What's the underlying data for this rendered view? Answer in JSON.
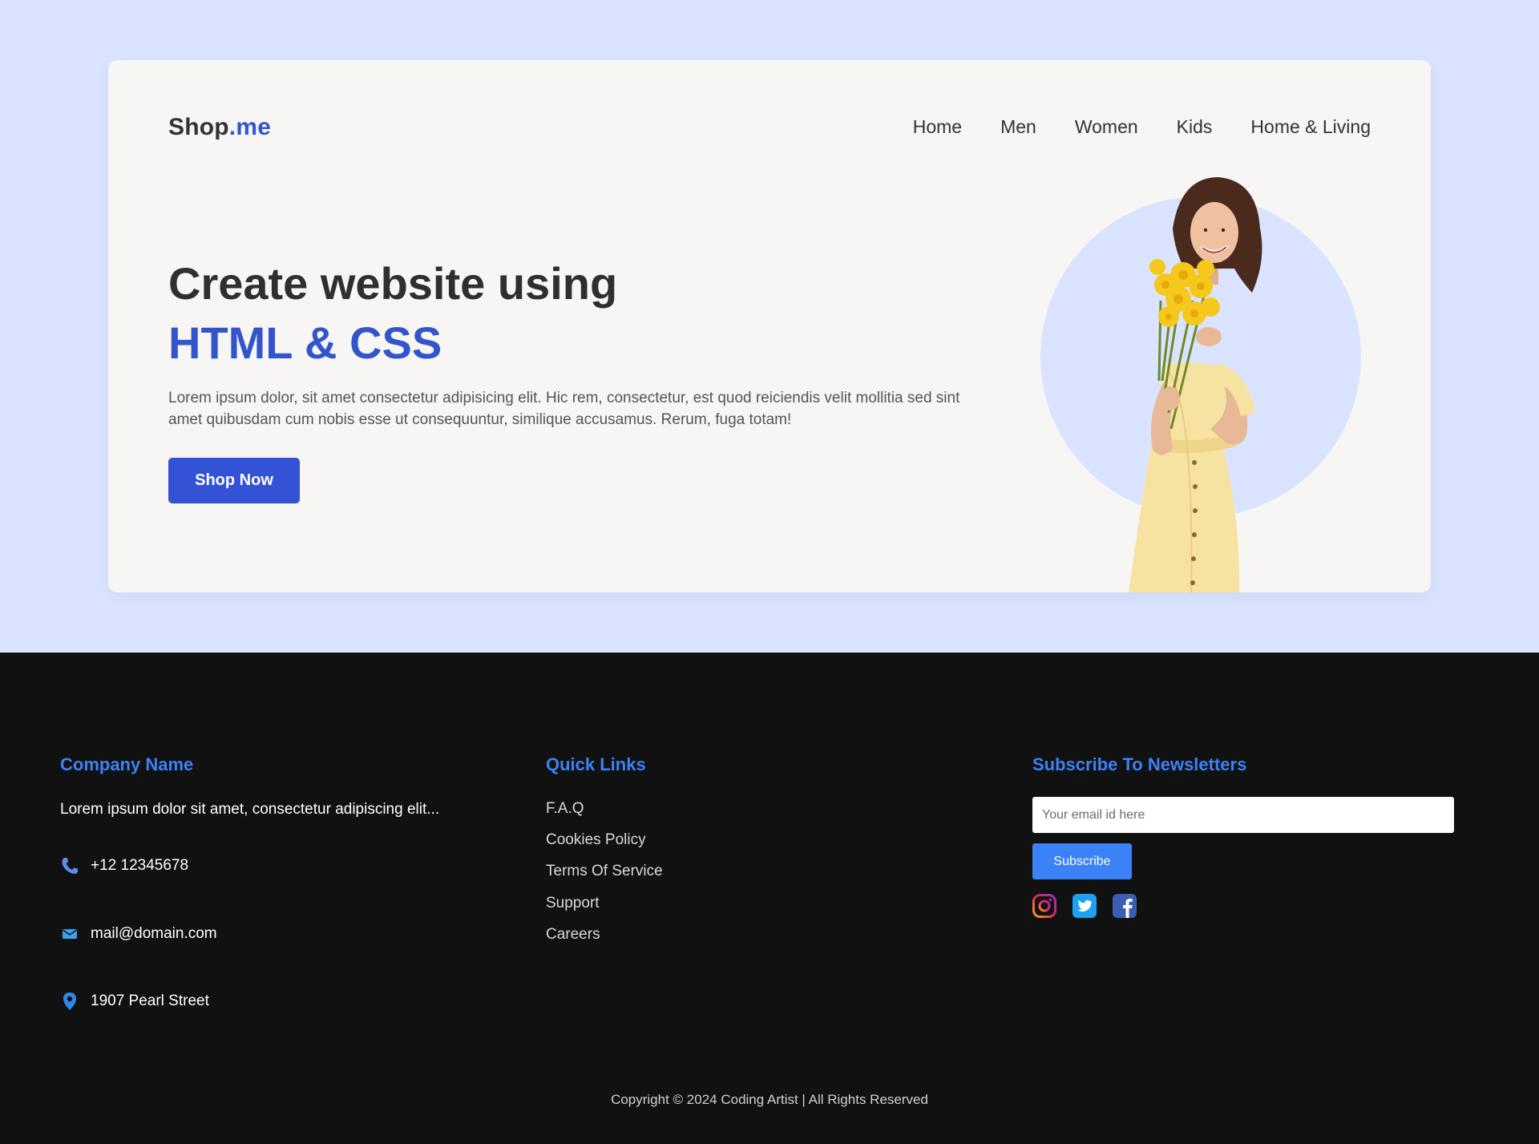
{
  "header": {
    "logo_main": "Shop",
    "logo_accent": ".me",
    "nav": [
      "Home",
      "Men",
      "Women",
      "Kids",
      "Home & Living"
    ]
  },
  "hero": {
    "headline_line1": "Create website using",
    "headline_line2": "HTML & CSS",
    "description": "Lorem ipsum dolor, sit amet consectetur adipisicing elit. Hic rem, consectetur, est quod reiciendis velit mollitia sed sint amet quibusdam cum nobis esse ut consequuntur, similique accusamus. Rerum, fuga totam!",
    "cta_label": "Shop Now",
    "image_icon": "woman-with-flowers-illustration"
  },
  "footer": {
    "company": {
      "title": "Company Name",
      "description": "Lorem ipsum dolor sit amet, consectetur adipiscing elit...",
      "phone": "+12 12345678",
      "email": "mail@domain.com",
      "address": "1907 Pearl Street",
      "icons": [
        "phone-icon",
        "mail-icon",
        "location-pin-icon"
      ]
    },
    "quick_links": {
      "title": "Quick Links",
      "items": [
        "F.A.Q",
        "Cookies Policy",
        "Terms Of Service",
        "Support",
        "Careers"
      ]
    },
    "newsletter": {
      "title": "Subscribe To Newsletters",
      "placeholder": "Your email id here",
      "button_label": "Subscribe",
      "social": [
        "instagram-icon",
        "twitter-icon",
        "facebook-icon"
      ]
    },
    "copyright": "Copyright © 2024 Coding Artist | All Rights Reserved"
  },
  "colors": {
    "page_bg": "#dae3ff",
    "card_bg": "#f8f6f4",
    "accent": "#3355cc",
    "footer_bg": "#111111",
    "footer_accent": "#3b82f6"
  }
}
